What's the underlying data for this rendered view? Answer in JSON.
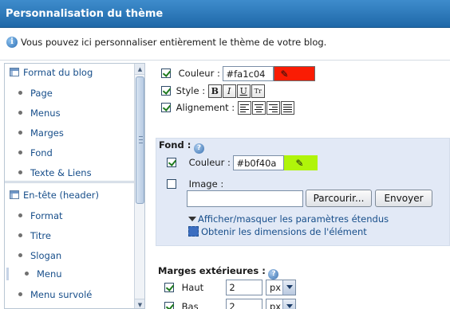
{
  "header": {
    "title": "Personnalisation du thème"
  },
  "info": {
    "text": "Vous pouvez ici personnaliser entièrement le thème de votre blog."
  },
  "sidebar": {
    "sections": [
      {
        "label": "Format du blog",
        "items": [
          "Page",
          "Menus",
          "Marges",
          "Fond",
          "Texte & Liens"
        ]
      },
      {
        "label": "En-tête (header)",
        "items": [
          "Format",
          "Titre",
          "Slogan",
          "Menu",
          "Menu survolé"
        ]
      }
    ],
    "active_item": "Menu"
  },
  "text_block": {
    "couleur_label": "Couleur :",
    "couleur_value": "#fa1c04",
    "couleur_swatch": "#fa1c04",
    "style_label": "Style :",
    "style_buttons": [
      "B",
      "I",
      "U",
      "Tr"
    ],
    "alignement_label": "Alignement :"
  },
  "fond": {
    "title": "Fond :",
    "couleur_label": "Couleur :",
    "couleur_value": "#b0f40a",
    "couleur_swatch": "#b0f40a",
    "image_label": "Image :",
    "browse_label": "Parcourir...",
    "send_label": "Envoyer",
    "toggle_link": "Afficher/masquer les paramètres étendus",
    "dimensions_link": "Obtenir les dimensions de l'élément"
  },
  "marges": {
    "title": "Marges extérieures :",
    "rows": [
      {
        "label": "Haut",
        "value": "2",
        "unit": "px"
      },
      {
        "label": "Bas",
        "value": "2",
        "unit": "px"
      }
    ]
  }
}
